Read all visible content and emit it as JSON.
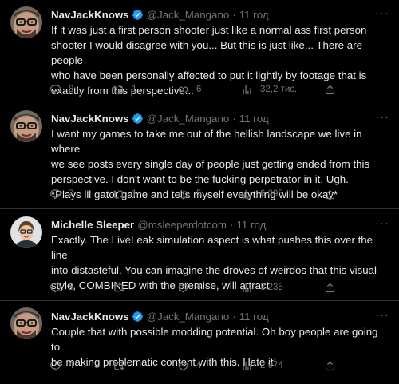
{
  "tweets": [
    {
      "name": "NavJackKnows",
      "handle": "@Jack_Mangano",
      "separator": "·",
      "time": "11 год",
      "text_lines": [
        "If it was just a first person shooter just like a normal ass first person",
        "shooter I would disagree with you... But this is just like... There are people",
        "who have been personally affected to put it lightly by footage that is",
        "exactly from this perspective..."
      ],
      "replies": "8",
      "retweets": "1",
      "likes": "6",
      "views": "32,2 тис."
    },
    {
      "name": "NavJackKnows",
      "handle": "@Jack_Mangano",
      "separator": "·",
      "time": "11 год",
      "text_lines": [
        "I want my games to take me out of the hellish landscape we live in where",
        "we see posts every single day of people just getting ended from this",
        "perspective. I don't want to be the fucking perpetrator in it. Ugh.",
        "*Plays lil gator game and tells myself everything will be okay*"
      ],
      "replies": "7",
      "retweets": "1",
      "likes": "5",
      "views": "6 095"
    },
    {
      "name": "Michelle Sleeper",
      "handle": "@msleeperdotcom",
      "separator": "·",
      "time": "11 год",
      "text_lines": [
        "Exactly. The LiveLeak simulation aspect is what pushes this over the line",
        "into distasteful. You can imagine the droves of weirdos that this visual",
        "style, COMBINED with the premise, will attract"
      ],
      "replies": "2",
      "retweets": "",
      "likes": "4",
      "views": "3 235"
    },
    {
      "name": "NavJackKnows",
      "handle": "@Jack_Mangano",
      "separator": "·",
      "time": "11 год",
      "text_lines": [
        "Couple that with possible modding potential. Oh boy people are going to",
        "be making problematic content with this. Hate it!"
      ],
      "replies": "4",
      "retweets": "",
      "likes": "4",
      "views": "2 974"
    }
  ],
  "icons": {
    "reply": "reply-icon",
    "retweet": "retweet-icon",
    "like": "like-icon",
    "views": "views-icon",
    "share": "share-icon",
    "more": "more-icon",
    "verified": "verified-badge-icon"
  },
  "colors": {
    "background": "#000000",
    "text": "#e7e9ea",
    "muted": "#71767b",
    "verified": "#1d9bf0",
    "divider": "#2f3336"
  }
}
